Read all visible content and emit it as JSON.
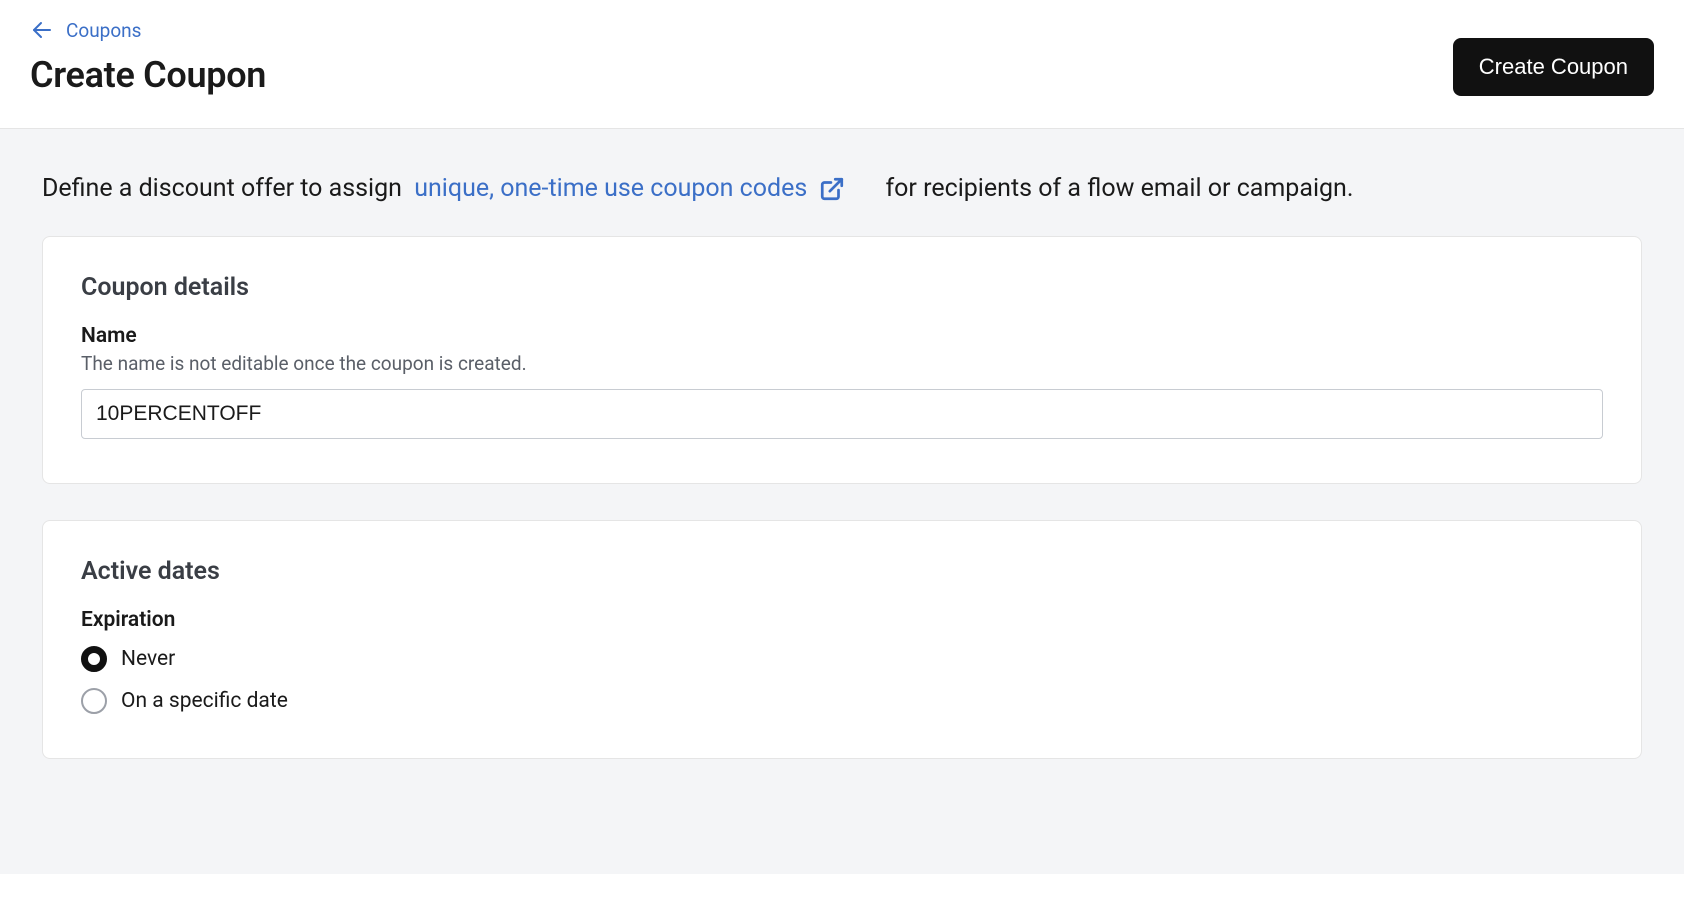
{
  "breadcrumb": {
    "label": "Coupons"
  },
  "page": {
    "title": "Create Coupon"
  },
  "actions": {
    "create_button": "Create Coupon"
  },
  "intro": {
    "prefix": "Define a discount offer to assign ",
    "link_text": "unique, one-time use coupon codes",
    "suffix": " for recipients of a flow email or campaign."
  },
  "coupon_details": {
    "heading": "Coupon details",
    "name_label": "Name",
    "name_hint": "The name is not editable once the coupon is created.",
    "name_value": "10PERCENTOFF"
  },
  "active_dates": {
    "heading": "Active dates",
    "expiration_label": "Expiration",
    "options": {
      "never": "Never",
      "specific": "On a specific date"
    },
    "selected": "never"
  }
}
